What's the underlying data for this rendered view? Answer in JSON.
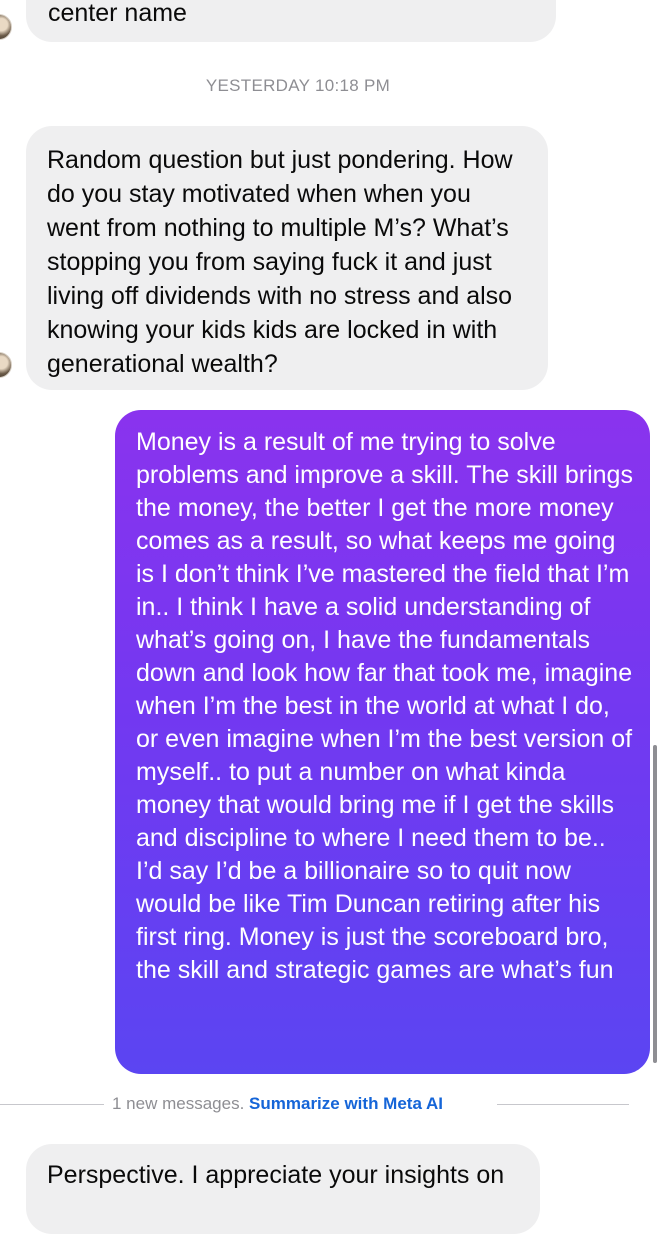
{
  "conversation": {
    "messages": [
      {
        "direction": "incoming",
        "text": "center name"
      },
      {
        "direction": "incoming",
        "text": "Random question but just pondering. How do you stay motivated when when you went from nothing to multiple M’s? What’s stopping you from saying fuck it and just living off dividends with no stress and also knowing your kids kids are locked in with generational wealth?"
      },
      {
        "direction": "outgoing",
        "text": "Money is a result of me trying to solve problems and improve a skill. The skill brings the money, the better I get the more money comes as a result, so what keeps me going is I don’t think I’ve mastered the field that I’m in.. I think I have a solid understanding of what’s going on, I have the fundamentals down and look how far that took me, imagine when I’m the best in the world at what I do, or even imagine when I’m the best version of myself.. to put a number on what kinda money that would bring me if I get the skills and discipline to where I need them to be.. I’d say I’d be a billionaire so to quit now would be like Tim Duncan retiring after his first ring. Money is just the scoreboard bro, the skill and strategic games are what’s fun"
      },
      {
        "direction": "incoming",
        "text": "Perspective. I appreciate your insights on"
      }
    ],
    "timestamp": "YESTERDAY 10:18 PM",
    "new_messages": {
      "label": "1 new messages.",
      "link": "Summarize with Meta AI"
    }
  },
  "colors": {
    "incoming_bubble": "#efeff0",
    "outgoing_gradient_top": "#8a33ee",
    "outgoing_gradient_bottom": "#5b45f2",
    "link": "#1565d8",
    "meta_text": "#8e8e93"
  }
}
